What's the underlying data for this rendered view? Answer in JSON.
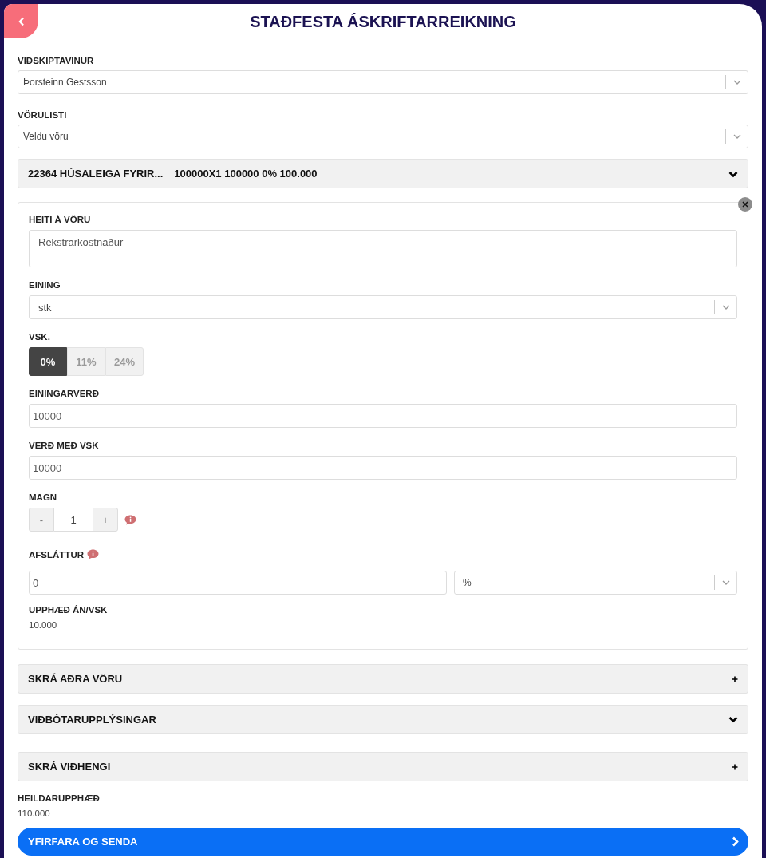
{
  "title": "STAÐFESTA ÁSKRIFTARREIKNING",
  "customer": {
    "label": "VIÐSKIPTAVINUR",
    "value": "Þorsteinn Gestsson"
  },
  "product_list": {
    "label": "VÖRULISTI",
    "placeholder": "Veldu vöru"
  },
  "line_item": {
    "name": "22364 HÚSALEIGA FYRIR...",
    "summary": "100000X1 100000 0% 100.000",
    "product_name": {
      "label": "HEITI Á VÖRU",
      "value": "Rekstrarkostnaður"
    },
    "unit": {
      "label": "EINING",
      "value": "stk"
    },
    "vat": {
      "label": "VSK.",
      "options": [
        {
          "label": "0%",
          "selected": true
        },
        {
          "label": "11%",
          "selected": false
        },
        {
          "label": "24%",
          "selected": false
        }
      ]
    },
    "unit_price": {
      "label": "EININGARVERÐ",
      "value": "10000"
    },
    "price_with_vat": {
      "label": "VERÐ MEÐ VSK",
      "value": "10000"
    },
    "quantity": {
      "label": "MAGN",
      "minus": "-",
      "value": "1",
      "plus": "+"
    },
    "discount": {
      "label": "AFSLÁTTUR",
      "value": "0",
      "unit": "%"
    },
    "amount": {
      "label": "UPPHÆÐ ÁN/VSK",
      "value": "10.000"
    }
  },
  "sections": [
    {
      "title": "SKRÁ AÐRA VÖRU",
      "kind": "plus"
    },
    {
      "title": "VIÐBÓTARUPPLÝSINGAR",
      "kind": "chevron"
    },
    {
      "title": "SKRÁ VIÐHENGI",
      "kind": "plus"
    }
  ],
  "total": {
    "label": "HEILDARUPPHÆÐ",
    "value": "110.000"
  },
  "submit": {
    "label": "YFIRFARA OG SENDA"
  }
}
